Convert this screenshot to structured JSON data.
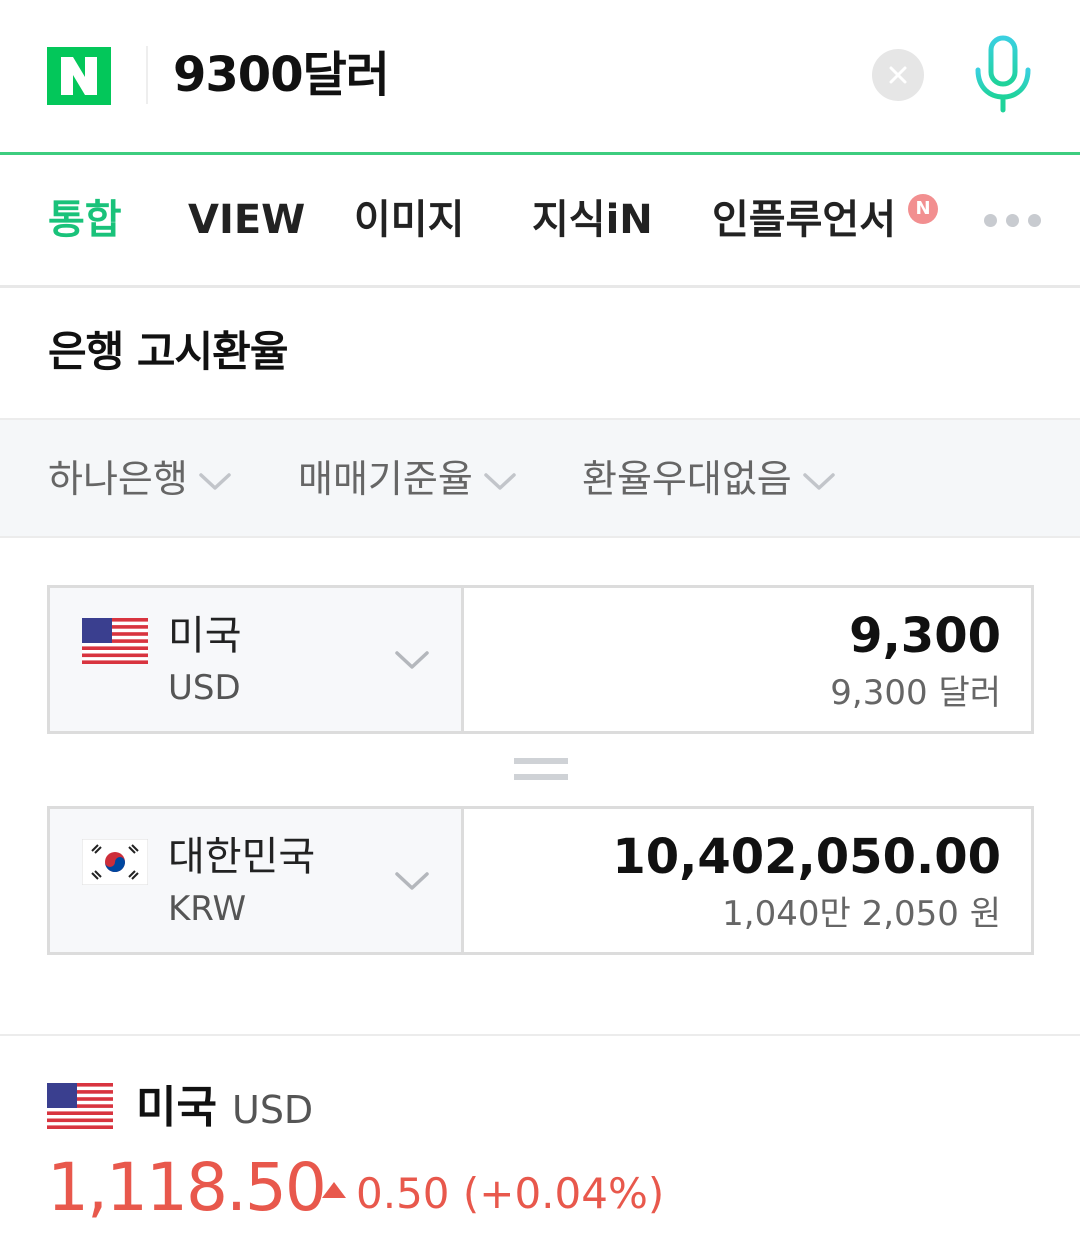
{
  "search": {
    "query": "9300달러"
  },
  "tabs": [
    {
      "label": "통합"
    },
    {
      "label": "VIEW"
    },
    {
      "label": "이미지"
    },
    {
      "label": "지식iN"
    },
    {
      "label": "인플루언서"
    }
  ],
  "tab_new_badge": "N",
  "section": {
    "title": "은행 고시환율"
  },
  "filters": [
    {
      "label": "하나은행"
    },
    {
      "label": "매매기준율"
    },
    {
      "label": "환율우대없음"
    }
  ],
  "converter": {
    "from": {
      "country": "미국",
      "code": "USD",
      "amount": "9,300",
      "amount_text": "9,300 달러"
    },
    "to": {
      "country": "대한민국",
      "code": "KRW",
      "amount": "10,402,050.00",
      "amount_text": "1,040만 2,050 원"
    }
  },
  "rate": {
    "country": "미국",
    "code": "USD",
    "value": "1,118.50",
    "change": "0.50 (+0.04%)"
  },
  "colors": {
    "brand_green": "#03c75a",
    "active_tab": "#19c27a",
    "rate_up": "#e8584c",
    "mic": "#2fd6b0"
  }
}
